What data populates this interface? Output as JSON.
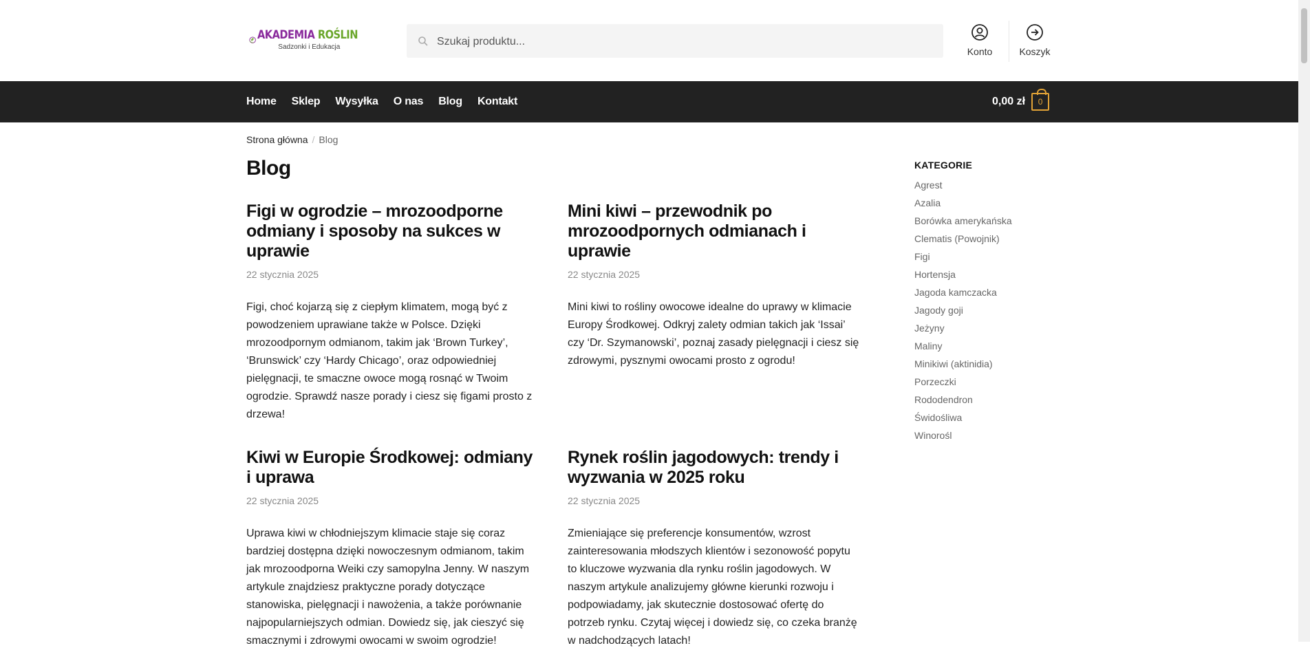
{
  "brand": {
    "name_part1": "AKADEMIA ",
    "name_part2": "ROŚLIN",
    "tagline": "Sadzonki i Edukacja",
    "color_purple": "#8a2b9c",
    "color_green": "#6aa62a"
  },
  "search": {
    "placeholder": "Szukaj produktu..."
  },
  "header": {
    "account_label": "Konto",
    "cart_label": "Koszyk"
  },
  "nav": {
    "items": [
      "Home",
      "Sklep",
      "Wysyłka",
      "O nas",
      "Blog",
      "Kontakt"
    ]
  },
  "cart": {
    "total": "0,00 zł",
    "count": "0",
    "accent": "#e2a336"
  },
  "breadcrumb": {
    "home": "Strona główna",
    "separator": "/",
    "current": "Blog"
  },
  "page": {
    "title": "Blog"
  },
  "posts": [
    {
      "title": "Figi w ogrodzie – mrozoodporne odmiany i sposoby na sukces w uprawie",
      "date": "22 stycznia 2025",
      "excerpt": "Figi, choć kojarzą się z ciepłym klimatem, mogą być z powodzeniem uprawiane także w Polsce. Dzięki mrozoodpornym odmianom, takim jak ‘Brown Turkey’, ‘Brunswick’ czy ‘Hardy Chicago’, oraz odpowiedniej pielęgnacji, te smaczne owoce mogą rosnąć w Twoim ogrodzie. Sprawdź nasze porady i ciesz się figami prosto z drzewa!"
    },
    {
      "title": "Mini kiwi – przewodnik po mrozoodpornych odmianach i uprawie",
      "date": "22 stycznia 2025",
      "excerpt": "Mini kiwi to rośliny owocowe idealne do uprawy w klimacie Europy Środkowej. Odkryj zalety odmian takich jak ‘Issai’ czy ‘Dr. Szymanowski’, poznaj zasady pielęgnacji i ciesz się zdrowymi, pysznymi owocami prosto z ogrodu!"
    },
    {
      "title": "Kiwi w Europie Środkowej: odmiany i uprawa",
      "date": "22 stycznia 2025",
      "excerpt": "Uprawa kiwi w chłodniejszym klimacie staje się coraz bardziej dostępna dzięki nowoczesnym odmianom, takim jak mrozoodporna Weiki czy samopylna Jenny. W naszym artykule znajdziesz praktyczne porady dotyczące stanowiska, pielęgnacji i nawożenia, a także porównanie najpopularniejszych odmian. Dowiedz się, jak cieszyć się smacznymi i zdrowymi owocami w swoim ogrodzie!"
    },
    {
      "title": "Rynek roślin jagodowych: trendy i wyzwania w 2025 roku",
      "date": "22 stycznia 2025",
      "excerpt": "Zmieniające się preferencje konsumentów, wzrost zainteresowania młodszych klientów i sezonowość popytu to kluczowe wyzwania dla rynku roślin jagodowych. W naszym artykule analizujemy główne kierunki rozwoju i podpowiadamy, jak skutecznie dostosować ofertę do potrzeb rynku. Czytaj więcej i dowiedz się, co czeka branżę w nadchodzących latach!"
    }
  ],
  "sidebar": {
    "title": "KATEGORIE",
    "items": [
      "Agrest",
      "Azalia",
      "Borówka amerykańska",
      "Clematis (Powojnik)",
      "Figi",
      "Hortensja",
      "Jagoda kamczacka",
      "Jagody goji",
      "Jeżyny",
      "Maliny",
      "Minikiwi (aktinidia)",
      "Porzeczki",
      "Rododendron",
      "Świdośliwa",
      "Winorośl"
    ]
  }
}
